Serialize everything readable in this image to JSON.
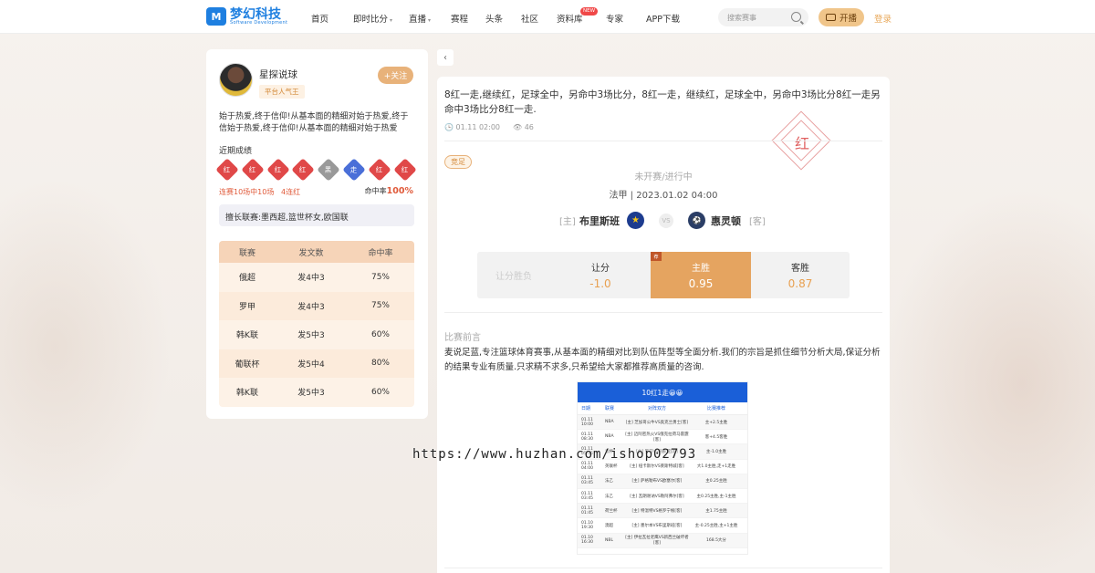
{
  "header": {
    "logo_title": "梦幻科技",
    "logo_sub": "Software Development",
    "nav": [
      {
        "label": "首页",
        "caret": false
      },
      {
        "label": "即时比分",
        "caret": true
      },
      {
        "label": "直播",
        "caret": true
      },
      {
        "label": "赛程",
        "caret": false
      },
      {
        "label": "头条",
        "caret": false
      },
      {
        "label": "社区",
        "caret": false
      },
      {
        "label": "资料库",
        "caret": false
      },
      {
        "label": "专家",
        "caret": false
      },
      {
        "label": "APP下载",
        "caret": false
      }
    ],
    "new_badge": "NEW",
    "search_placeholder": "搜索赛事",
    "live_button": "开播",
    "login": "登录",
    "brand_color": "#1e7fe0",
    "accent_color": "#e8b27a"
  },
  "expert": {
    "name": "星探说球",
    "tag": "平台人气王",
    "follow_label": "+关注",
    "bio": "始于热爱,终于信仰!从基本面的精细对始于热爱,终于信始于热爱,终于信仰!从基本面的精细对始于热爱",
    "recent_title": "近期成绩",
    "results": [
      {
        "label": "红",
        "color": "#e04848"
      },
      {
        "label": "红",
        "color": "#e04848"
      },
      {
        "label": "红",
        "color": "#e04848"
      },
      {
        "label": "红",
        "color": "#e04848"
      },
      {
        "label": "黑",
        "color": "#999999"
      },
      {
        "label": "走",
        "color": "#4a6fd8"
      },
      {
        "label": "红",
        "color": "#e04848"
      },
      {
        "label": "红",
        "color": "#e04848"
      }
    ],
    "streak_text": "连赛10场中10场",
    "streak_count": "4连红",
    "hit_rate_label": "命中率",
    "hit_rate_value": "100%",
    "league_text": "擅长联赛:墨西超,篮世杯女,欧国联",
    "stats_headers": [
      "联赛",
      "发文数",
      "命中率"
    ],
    "stats_rows": [
      [
        "俄超",
        "发4中3",
        "75%"
      ],
      [
        "罗甲",
        "发4中3",
        "75%"
      ],
      [
        "韩K联",
        "发5中3",
        "60%"
      ],
      [
        "葡联杯",
        "发5中4",
        "80%"
      ],
      [
        "韩K联",
        "发5中3",
        "60%"
      ]
    ]
  },
  "article": {
    "back_icon": "chevron-left-icon",
    "title": "8红一走,继续红，足球全中，另命中3场比分，8红一走，继续红，足球全中，另命中3场比分8红一走另命中3场比分8红一走.",
    "date": "01.11  02:00",
    "views": "46",
    "stamp": "红",
    "sport_tag": "竞足",
    "match_status": "未开赛/进行中",
    "match_line": "法甲  |  2023.01.02  04:00",
    "home_tag": "[主]",
    "home_team": "布里斯班",
    "vs": "VS",
    "away_team": "惠灵顿",
    "away_tag": "[客]",
    "odds": [
      {
        "label": "让分胜负",
        "value": "",
        "selected": false,
        "first": true
      },
      {
        "label": "让分",
        "value": "-1.0",
        "selected": false,
        "first": false
      },
      {
        "label": "主胜",
        "value": "0.95",
        "selected": true,
        "first": false,
        "corner": "荐"
      },
      {
        "label": "客胜",
        "value": "0.87",
        "selected": false,
        "first": false
      }
    ],
    "section_title": "比赛前言",
    "body": "麦说足蓝,专注篮球体育赛事,从基本面的精细对比到队伍阵型等全面分析.我们的宗旨是抓住细节分析大局,保证分析的结果专业有质量.只求精不求多,只希望给大家都推荐高质量的咨询.",
    "image": {
      "header": "10红1走😀😀",
      "columns": [
        "日期",
        "联赛",
        "对阵双方",
        "比赛推荐"
      ],
      "rows": [
        [
          "01.11  10:00",
          "NBA",
          "[主] 芝加哥公牛VS奥克兰勇士[客]",
          "主+2.5主胜"
        ],
        [
          "01.11  08:30",
          "NBA",
          "[主] 迈阿密热火VS俄克拉荷马雷霆[客]",
          "客+4.5客胜"
        ],
        [
          "01.11  05:45",
          "意杯",
          "[主] 罗马VS热那亚[客]",
          "主-1.0主胜"
        ],
        [
          "01.11  04:00",
          "英联杯",
          "[主] 纽卡斯尔VS莱斯特城[客]",
          "大1.0主胜,走+1走胜"
        ],
        [
          "01.11  03:45",
          "法乙",
          "[主] 萨格勒布VS欧塞尔[客]",
          "主0.25主胜"
        ],
        [
          "01.11  03:45",
          "法乙",
          "[主] 瓦朗谢讷VS勒阿弗尔[客]",
          "主0.25主胜,主-1主胜"
        ],
        [
          "01.11  01:45",
          "荷兰杯",
          "[主] 特温特VS格罗宁根[客]",
          "主1.75主胜"
        ],
        [
          "01.10  19:30",
          "澳超",
          "[主] 墨尔本VS布里斯班[客]",
          "主-0.25主胜,主+1主胜"
        ],
        [
          "01.10  16:30",
          "NBL",
          "[主] 伊拉瓦拉老鹰VS新西兰破坏者[客]",
          "168.5大分"
        ]
      ]
    }
  },
  "watermark": "https://www.huzhan.com/ishop02793"
}
